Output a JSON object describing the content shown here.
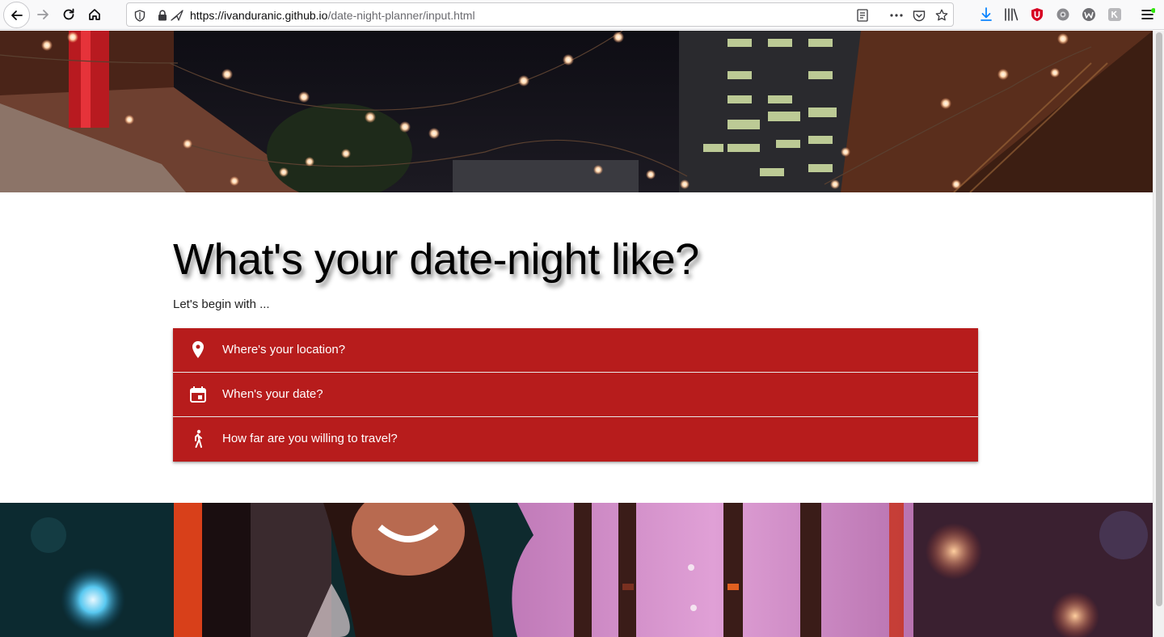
{
  "browser": {
    "url_host": "https://ivanduranic.github.io",
    "url_path": "/date-night-planner/input.html",
    "icons": [
      "back-icon",
      "forward-icon",
      "reload-icon",
      "home-icon",
      "shield-icon",
      "lock-icon",
      "tracking-icon",
      "reader-view-icon",
      "more-icon",
      "pocket-icon",
      "bookmark-star-icon",
      "download-icon",
      "library-icon",
      "ublock-icon",
      "extension-icon",
      "extension-icon",
      "extension-icon",
      "menu-icon"
    ]
  },
  "main": {
    "title": "What's your date-night like?",
    "subtitle": "Let's begin with ...",
    "items": [
      {
        "label": "Where's your location?",
        "icon": "location-pin-icon"
      },
      {
        "label": "When's your date?",
        "icon": "calendar-icon"
      },
      {
        "label": "How far are you willing to travel?",
        "icon": "walking-icon"
      }
    ]
  },
  "colors": {
    "accent": "#b71c1c",
    "text": "#000000"
  }
}
